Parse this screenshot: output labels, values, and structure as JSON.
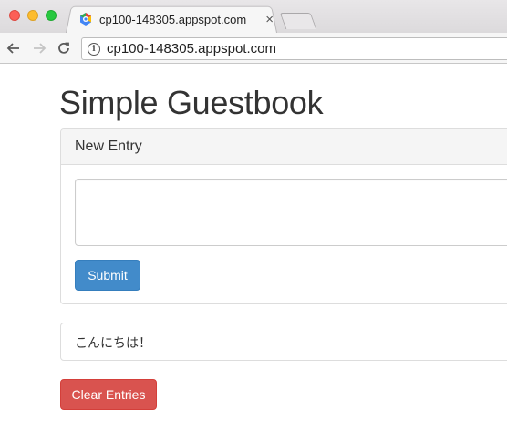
{
  "browser": {
    "tab_title": "cp100-148305.appspot.com",
    "tab_close": "×",
    "url": "cp100-148305.appspot.com",
    "info_glyph": "i"
  },
  "page": {
    "title": "Simple Guestbook",
    "new_entry_heading": "New Entry",
    "textarea_value": "",
    "submit_label": "Submit",
    "entries": [
      "こんにちは！"
    ],
    "clear_label": "Clear Entries"
  },
  "colors": {
    "submit_bg": "#428bca",
    "clear_bg": "#d9534f"
  }
}
